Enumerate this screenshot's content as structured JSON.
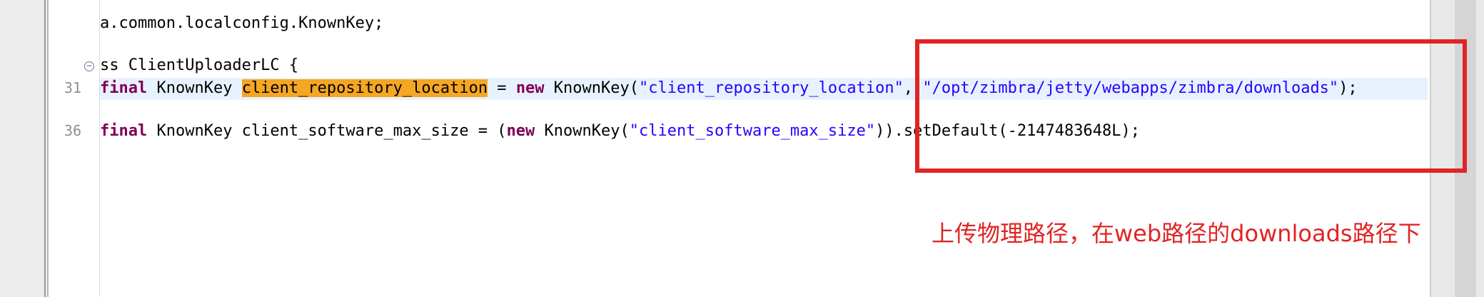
{
  "editor": {
    "line_numbers": {
      "l1": "31",
      "l2": "36"
    },
    "lines": {
      "import": {
        "text": "a.common.localconfig.KnownKey;"
      },
      "class_decl": {
        "text": "ss ClientUploaderLC {"
      },
      "l31": {
        "kw1": "final",
        "p1": " KnownKey ",
        "field": "client_repository_location",
        "p2": " = ",
        "kw2": "new",
        "p3": " KnownKey(",
        "s1": "\"client_repository_location\"",
        "p4": ", ",
        "s2": "\"/opt/zimbra/jetty/webapps/zimbra/downloads\"",
        "p5": ");"
      },
      "l36": {
        "kw1": "final",
        "p1": " KnownKey client_software_max_size = (",
        "kw2": "new",
        "p2": " KnownKey(",
        "s1": "\"client_software_max_size\"",
        "p3": ")).setDefault(-2147483648L);"
      }
    }
  },
  "annotation": {
    "text": "上传物理路径，在web路径的downloads路径下"
  },
  "colors": {
    "keyword": "#7f0055",
    "string": "#2a00ff",
    "occurrence_highlight": "#f5a623",
    "current_line": "#e8f2fe",
    "annotation_red": "#e02424"
  },
  "icons": {
    "fold": "collapse-icon"
  }
}
